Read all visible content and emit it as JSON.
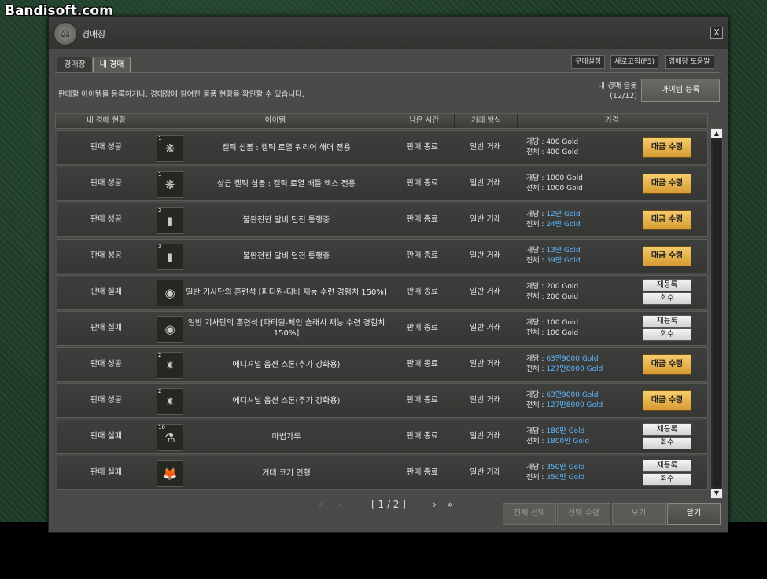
{
  "watermark": "Bandisoft.com",
  "window": {
    "title": "경매장",
    "close": "X"
  },
  "tabs": [
    {
      "label": "경매장"
    },
    {
      "label": "내 경매"
    }
  ],
  "top_buttons": {
    "buy_settings": "구매설정",
    "refresh": "새로고침(F5)",
    "help": "경매장 도움말"
  },
  "description": "판매할 아이템을 등록하거나, 경매장에 참여한 물품 현황을 확인할 수 있습니다.",
  "auction_count": {
    "label": "내 경매 슬롯",
    "value": "(12/12)"
  },
  "register_button": "아이템 등록",
  "columns": [
    "내 경매 현황",
    "아이템",
    "남은 시간",
    "거래 방식",
    "가격"
  ],
  "price_labels": {
    "each": "개당 : ",
    "total": "전체 : "
  },
  "buttons": {
    "claim": "대금 수령",
    "relist": "재등록",
    "retrieve": "회수"
  },
  "rows": [
    {
      "status": "판매 성공",
      "qty": "1",
      "icon": "rune-icon",
      "glyph": "❋",
      "name": "켈틱 심볼 : 켈틱 로열 워리어 해머 전용",
      "time": "판매 종료",
      "type": "일반 거래",
      "each": "400 Gold",
      "total": "400 Gold",
      "highlight": false,
      "action": "claim"
    },
    {
      "status": "판매 성공",
      "qty": "1",
      "icon": "rune-icon",
      "glyph": "❋",
      "name": "상급 켈틱 심볼 : 켈틱 로열 배틀 액스 전용",
      "time": "판매 종료",
      "type": "일반 거래",
      "each": "1000 Gold",
      "total": "1000 Gold",
      "highlight": false,
      "action": "claim"
    },
    {
      "status": "판매 성공",
      "qty": "2",
      "icon": "dungeon-pass-icon",
      "glyph": "▮",
      "name": "불완전한 알비 던전 통행증",
      "time": "판매 종료",
      "type": "일반 거래",
      "each": "12만 Gold",
      "total": "24만 Gold",
      "highlight": true,
      "action": "claim"
    },
    {
      "status": "판매 성공",
      "qty": "3",
      "icon": "dungeon-pass-icon",
      "glyph": "▮",
      "name": "불완전한 알비 던전 통행증",
      "time": "판매 종료",
      "type": "일반 거래",
      "each": "13만 Gold",
      "total": "39만 Gold",
      "highlight": true,
      "action": "claim"
    },
    {
      "status": "판매 실패",
      "qty": "",
      "icon": "training-stone-icon",
      "glyph": "◉",
      "name": "일반 기사단의 훈련석 [파티원-디바 재능 수련 경험치 150%]",
      "time": "판매 종료",
      "type": "일반 거래",
      "each": "200 Gold",
      "total": "200 Gold",
      "highlight": false,
      "action": "relist"
    },
    {
      "status": "판매 실패",
      "qty": "",
      "icon": "training-stone-icon",
      "glyph": "◉",
      "name": "일반 기사단의 훈련석 [파티원-체인 슬래시 재능 수련 경험치 150%]",
      "time": "판매 종료",
      "type": "일반 거래",
      "each": "100 Gold",
      "total": "100 Gold",
      "highlight": false,
      "action": "relist"
    },
    {
      "status": "판매 성공",
      "qty": "2",
      "icon": "option-stone-icon",
      "glyph": "✷",
      "name": "에디셔널 옵션 스톤(추가 강화용)",
      "time": "판매 종료",
      "type": "일반 거래",
      "each": "63만9000 Gold",
      "total": "127만8000 Gold",
      "highlight": true,
      "action": "claim"
    },
    {
      "status": "판매 성공",
      "qty": "2",
      "icon": "option-stone-icon",
      "glyph": "✷",
      "name": "에디셔널 옵션 스톤(추가 강화용)",
      "time": "판매 종료",
      "type": "일반 거래",
      "each": "63만9000 Gold",
      "total": "127만8000 Gold",
      "highlight": true,
      "action": "claim"
    },
    {
      "status": "판매 실패",
      "qty": "10",
      "icon": "magic-powder-icon",
      "glyph": "⚗",
      "name": "마법가루",
      "time": "판매 종료",
      "type": "일반 거래",
      "each": "180만 Gold",
      "total": "1800만 Gold",
      "highlight": true,
      "action": "relist"
    },
    {
      "status": "판매 실패",
      "qty": "",
      "icon": "giant-fox-icon",
      "glyph": "🦊",
      "name": "거대 코기 인형",
      "time": "판매 종료",
      "type": "일반 거래",
      "each": "350만 Gold",
      "total": "350만 Gold",
      "highlight": true,
      "action": "relist"
    }
  ],
  "pager": {
    "first": "«",
    "prev": "‹",
    "current": "[ 1 / 2 ]",
    "next": "›",
    "last": "»"
  },
  "bottom_buttons": {
    "select_all": "전체 선택",
    "claim_selected": "선택 수령",
    "view": "보기",
    "close": "닫기"
  }
}
